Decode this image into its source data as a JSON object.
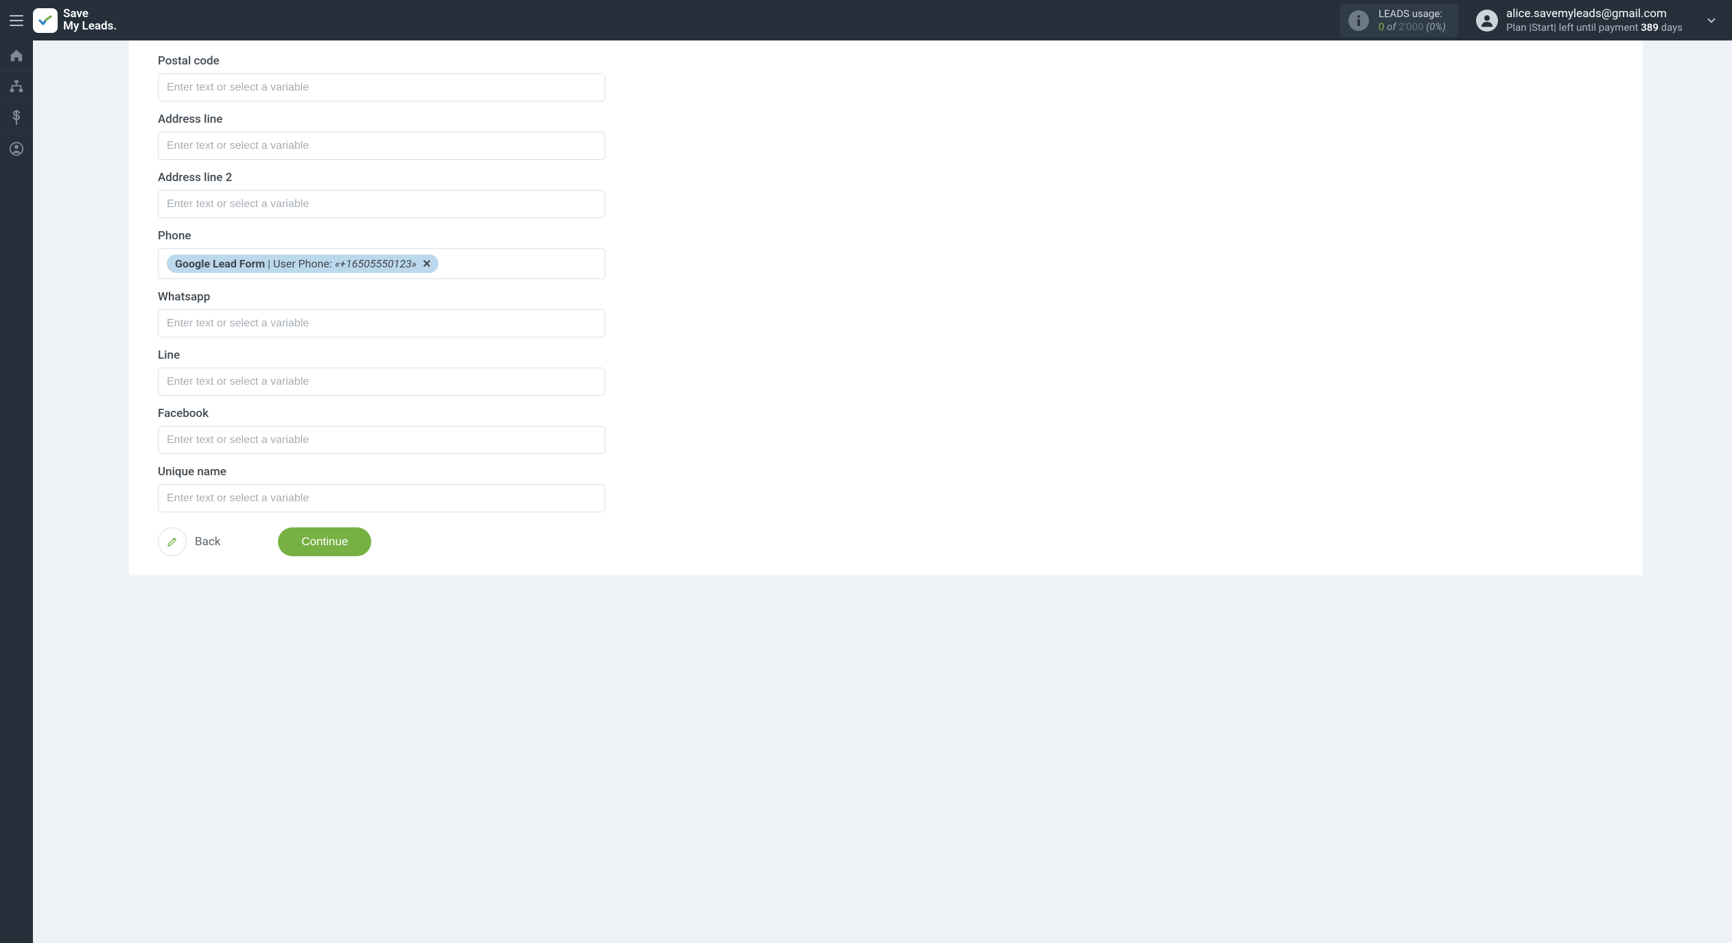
{
  "brand": {
    "line1": "Save",
    "line2": "My Leads."
  },
  "leads_usage": {
    "label": "LEADS usage:",
    "used": "0",
    "of_word": "of",
    "total": "2'000",
    "pct": "(0%)"
  },
  "account": {
    "email": "alice.savemyleads@gmail.com",
    "plan_prefix": "Plan |",
    "plan_name": "Start",
    "plan_mid": "| left until payment ",
    "days": "389",
    "plan_suffix": " days"
  },
  "form": {
    "placeholder": "Enter text or select a variable",
    "fields": {
      "postal_code": {
        "label": "Postal code"
      },
      "address_line": {
        "label": "Address line"
      },
      "address_line_2": {
        "label": "Address line 2"
      },
      "phone": {
        "label": "Phone",
        "chip": {
          "source": "Google Lead Form",
          "sep": " | ",
          "field": "User Phone: ",
          "value": "«+16505550123»",
          "close": "✕"
        }
      },
      "whatsapp": {
        "label": "Whatsapp"
      },
      "line": {
        "label": "Line"
      },
      "facebook": {
        "label": "Facebook"
      },
      "unique_name": {
        "label": "Unique name"
      }
    }
  },
  "actions": {
    "back": "Back",
    "continue": "Continue"
  }
}
